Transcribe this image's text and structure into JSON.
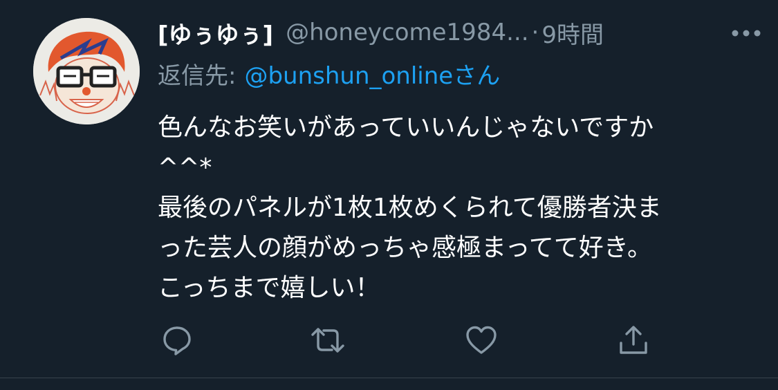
{
  "tweet": {
    "display_name": "[ゆぅゆぅ]",
    "handle": "@honeycome1984...",
    "separator": "·",
    "time": "9時間",
    "reply_prefix": "返信先:",
    "reply_target": "@bunshun_onlineさん",
    "lines": [
      "色んなお笑いがあっていいんじゃないですか",
      "^^*",
      "最後のパネルが1枚1枚めくられて優勝者決ま",
      "った芸人の顔がめっちゃ感極まってて好き。",
      "こっちまで嬉しい！"
    ]
  },
  "icons": {
    "more": "more-dots-icon",
    "reply": "reply-bubble-icon",
    "retweet": "retweet-icon",
    "like": "heart-icon",
    "share": "share-upload-icon"
  },
  "colors": {
    "background": "#15202b",
    "primary_text": "#ffffff",
    "secondary_text": "#8899a6",
    "link": "#1da1f2",
    "divider": "#38444d"
  }
}
